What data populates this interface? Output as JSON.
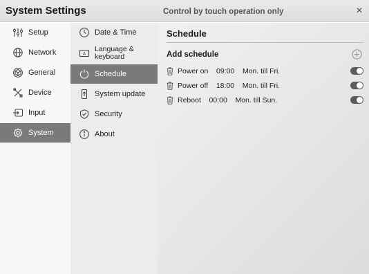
{
  "header": {
    "title": "System Settings",
    "note": "Control by touch operation only",
    "close_glyph": "×"
  },
  "primary_nav": [
    {
      "label": "Setup",
      "icon": "setup-sliders-icon",
      "active": false
    },
    {
      "label": "Network",
      "icon": "globe-icon",
      "active": false
    },
    {
      "label": "General",
      "icon": "cube-icon",
      "active": false
    },
    {
      "label": "Device",
      "icon": "tools-icon",
      "active": false
    },
    {
      "label": "Input",
      "icon": "input-icon",
      "active": false
    },
    {
      "label": "System",
      "icon": "gear-icon",
      "active": true
    }
  ],
  "secondary_nav": [
    {
      "label": "Date & Time",
      "icon": "clock-icon",
      "active": false
    },
    {
      "label": "Language & keyboard",
      "line1": "Language &",
      "line2": "keyboard",
      "icon": "keyboard-icon",
      "active": false
    },
    {
      "label": "Schedule",
      "icon": "power-icon",
      "active": true
    },
    {
      "label": "System update",
      "icon": "update-icon",
      "active": false
    },
    {
      "label": "Security",
      "icon": "shield-icon",
      "active": false
    },
    {
      "label": "About",
      "icon": "info-icon",
      "active": false
    }
  ],
  "schedule": {
    "title": "Schedule",
    "add_label": "Add schedule",
    "add_icon": "plus-circle-icon",
    "items": [
      {
        "action": "Power on",
        "time": "09:00",
        "days": "Mon. till Fri.",
        "enabled": true,
        "text": "Power on    09:00    Mon. till Fri."
      },
      {
        "action": "Power off",
        "time": "18:00",
        "days": "Mon. till Fri.",
        "enabled": true,
        "text": "Power off    18:00    Mon. till Fri."
      },
      {
        "action": "Reboot",
        "time": "00:00",
        "days": "Mon. till Sun.",
        "enabled": true,
        "text": "Reboot    00:00    Mon. till Sun."
      }
    ]
  },
  "colors": {
    "active_bg": "#7a7a7a",
    "toggle_on": "#5b5b5b"
  }
}
